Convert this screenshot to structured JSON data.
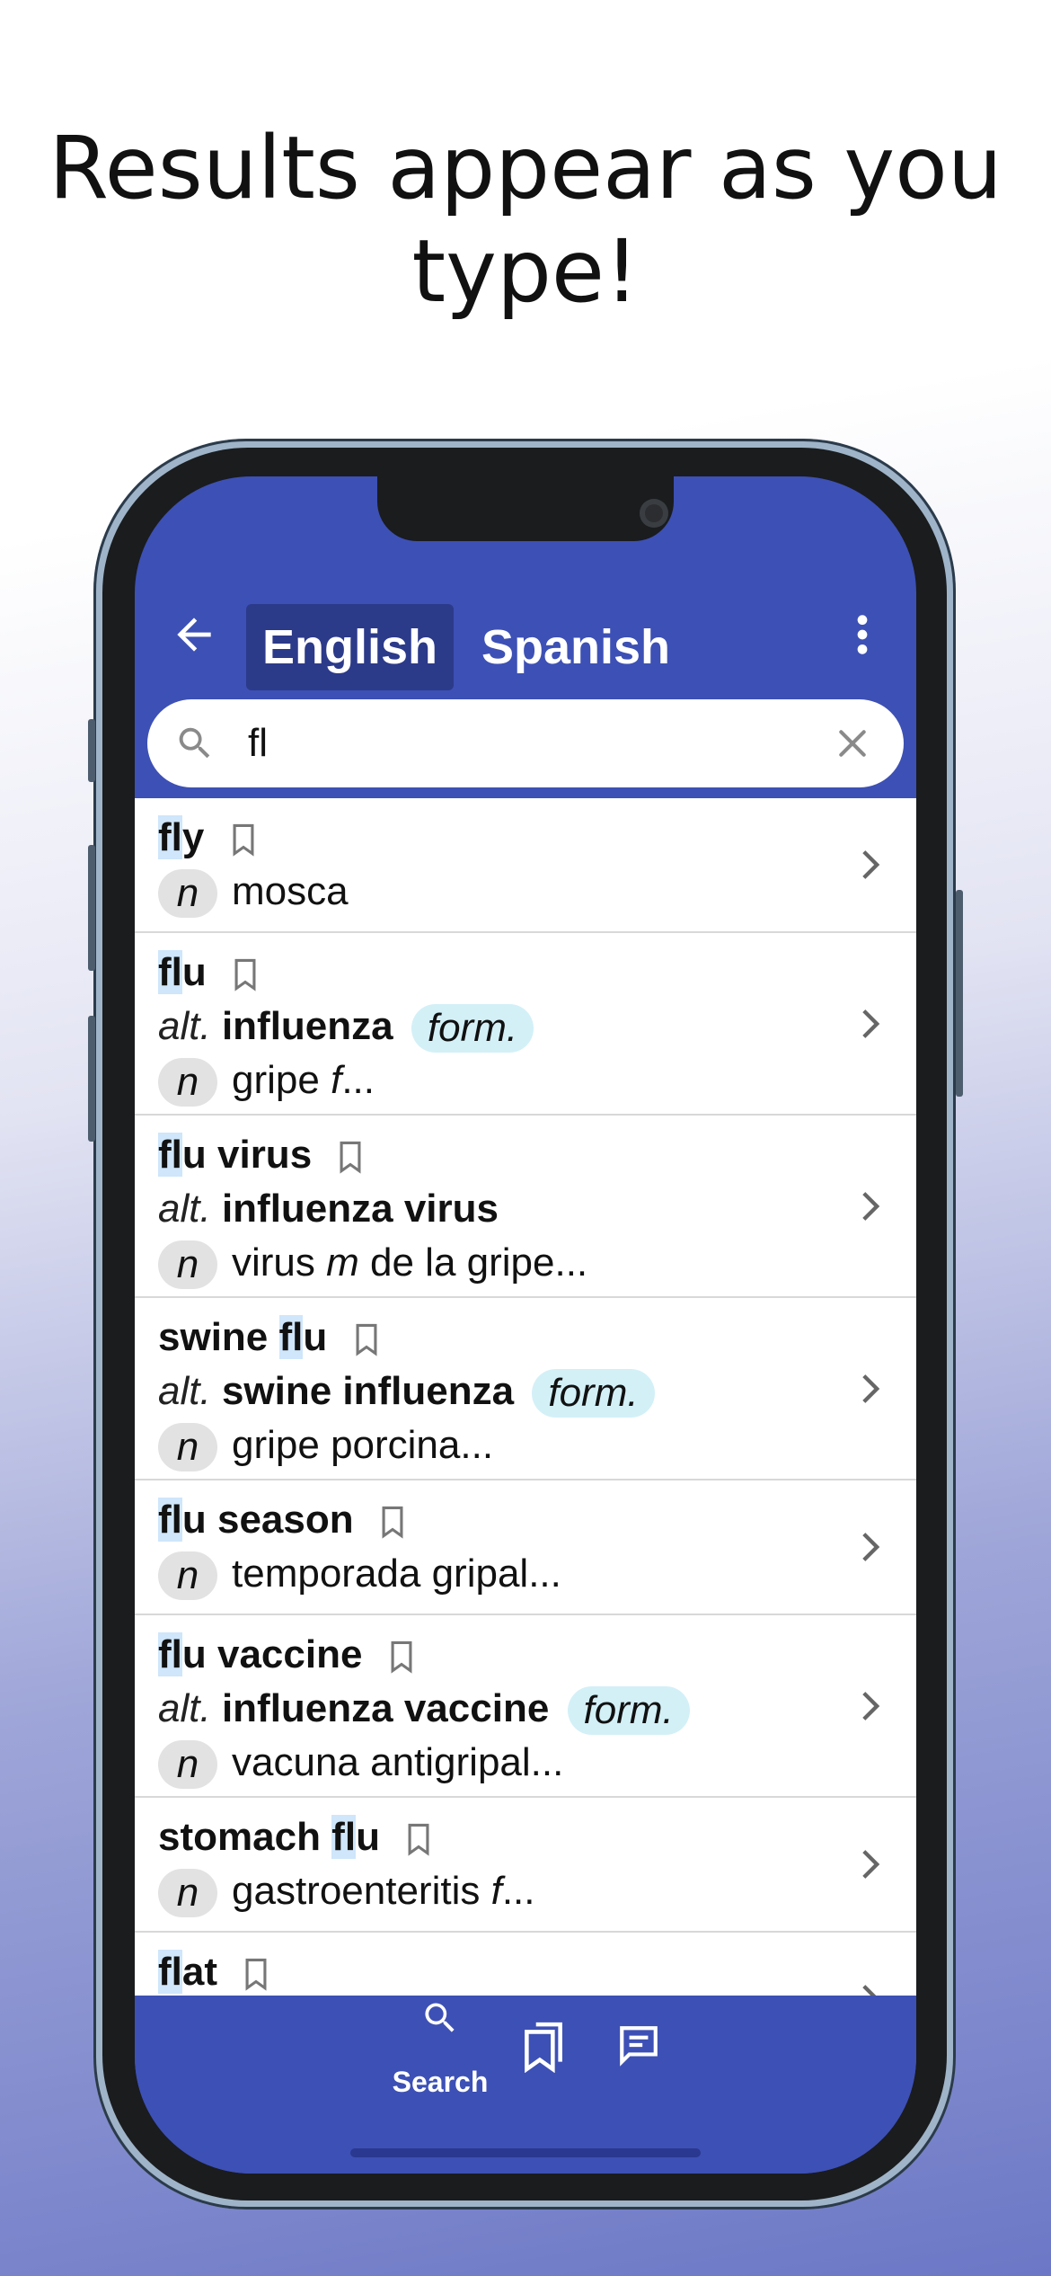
{
  "headline": "Results appear as you type!",
  "app": {
    "tabs": [
      {
        "label": "English",
        "active": true
      },
      {
        "label": "Spanish",
        "active": false
      }
    ],
    "search": {
      "value": "fl"
    },
    "results": [
      {
        "pre": "",
        "match": "fl",
        "post": "y",
        "alt": null,
        "form": null,
        "pos": "n",
        "trans": "mosca",
        "gender": "",
        "rest": ""
      },
      {
        "pre": "",
        "match": "fl",
        "post": "u",
        "alt": "influenza",
        "form": "form.",
        "pos": "n",
        "trans": "gripe ",
        "gender": "f",
        "rest": "..."
      },
      {
        "pre": "",
        "match": "fl",
        "post": "u virus",
        "alt": "influenza virus",
        "form": null,
        "pos": "n",
        "trans": "virus ",
        "gender": "m",
        "rest": " de la gripe..."
      },
      {
        "pre": "swine ",
        "match": "fl",
        "post": "u",
        "alt": "swine influenza",
        "form": "form.",
        "pos": "n",
        "trans": "gripe porcina...",
        "gender": "",
        "rest": ""
      },
      {
        "pre": "",
        "match": "fl",
        "post": "u season",
        "alt": null,
        "form": null,
        "pos": "n",
        "trans": "temporada gripal...",
        "gender": "",
        "rest": ""
      },
      {
        "pre": "",
        "match": "fl",
        "post": "u vaccine",
        "alt": "influenza vaccine",
        "form": "form.",
        "pos": "n",
        "trans": "vacuna antigripal...",
        "gender": "",
        "rest": ""
      },
      {
        "pre": "stomach ",
        "match": "fl",
        "post": "u",
        "alt": null,
        "form": null,
        "pos": "n",
        "trans": "gastroenteritis ",
        "gender": "f",
        "rest": "..."
      },
      {
        "pre": "",
        "match": "fl",
        "post": "at",
        "alt": null,
        "form": null,
        "pos": null,
        "trans": "",
        "gender": "",
        "rest": ""
      }
    ],
    "alt_prefix": "alt.",
    "nav": {
      "search_label": "Search"
    }
  },
  "colors": {
    "primary": "#3d50b5",
    "active_tab": "#2c3a8a",
    "highlight": "#cfe6fb",
    "form_badge": "#d3f0f7"
  },
  "icons": [
    "back-arrow-icon",
    "more-vert-icon",
    "search-icon",
    "close-icon",
    "bookmark-icon",
    "chevron-right-icon",
    "bookmarks-icon",
    "chat-icon"
  ]
}
